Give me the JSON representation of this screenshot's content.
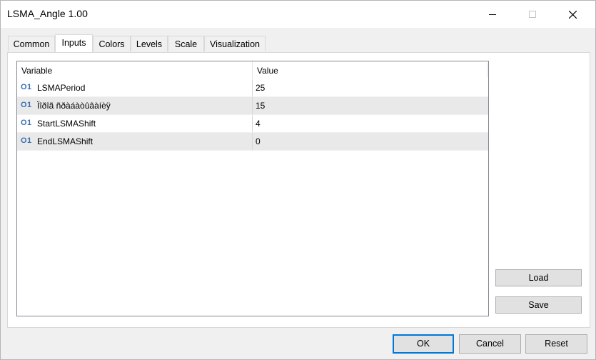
{
  "window": {
    "title": "LSMA_Angle 1.00",
    "controls": {
      "minimize": "minimize-icon",
      "maximize": "maximize-icon",
      "close": "close-icon"
    }
  },
  "tabs": [
    {
      "label": "Common",
      "active": false
    },
    {
      "label": "Inputs",
      "active": true
    },
    {
      "label": "Colors",
      "active": false
    },
    {
      "label": "Levels",
      "active": false
    },
    {
      "label": "Scale",
      "active": false
    },
    {
      "label": "Visualization",
      "active": false
    }
  ],
  "grid": {
    "headers": {
      "variable": "Variable",
      "value": "Value"
    },
    "type_icon": "O1",
    "rows": [
      {
        "variable": "LSMAPeriod",
        "value": "25"
      },
      {
        "variable": "Ïîðîã ñðàáàòûâàíèÿ",
        "value": "15"
      },
      {
        "variable": "StartLSMAShift",
        "value": "4"
      },
      {
        "variable": "EndLSMAShift",
        "value": "0"
      }
    ]
  },
  "side_buttons": {
    "load": "Load",
    "save": "Save"
  },
  "footer": {
    "ok": "OK",
    "cancel": "Cancel",
    "reset": "Reset"
  },
  "colors": {
    "accent": "#0078d7",
    "type_icon": "#3a6fb0"
  }
}
